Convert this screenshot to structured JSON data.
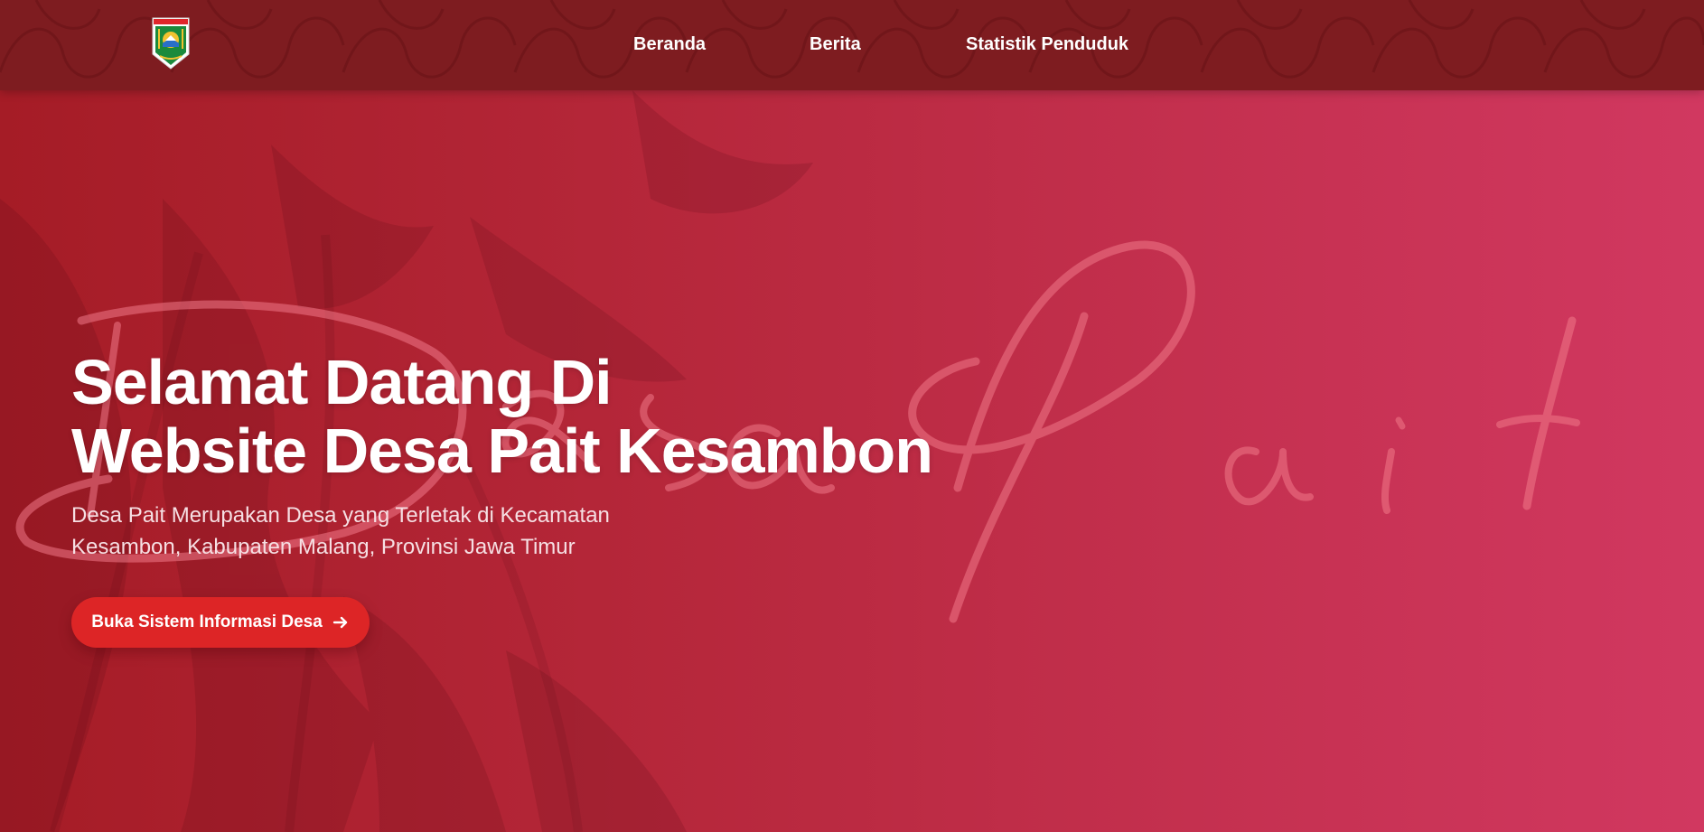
{
  "header": {
    "logo_icon": "kabupaten-malang-crest-icon",
    "nav": [
      {
        "label": "Beranda"
      },
      {
        "label": "Berita"
      },
      {
        "label": "Statistik Penduduk"
      }
    ]
  },
  "hero": {
    "title_lines": [
      "Selamat Datang Di",
      "Website Desa Pait Kesambon"
    ],
    "subtitle_lines": [
      "Desa Pait Merupakan Desa yang Terletak di Kecamatan",
      "Kesambon, Kabupaten Malang, Provinsi Jawa Timur"
    ],
    "watermark_text": "Desa Pait",
    "cta_label": "Buka Sistem Informasi Desa",
    "cta_icon": "arrow-right-icon"
  },
  "colors": {
    "navbar": "#7e1c20",
    "hero_gradient_start": "#a51c26",
    "hero_gradient_end": "#d13860",
    "cta_button": "#dd2526",
    "text": "#ffffff"
  }
}
